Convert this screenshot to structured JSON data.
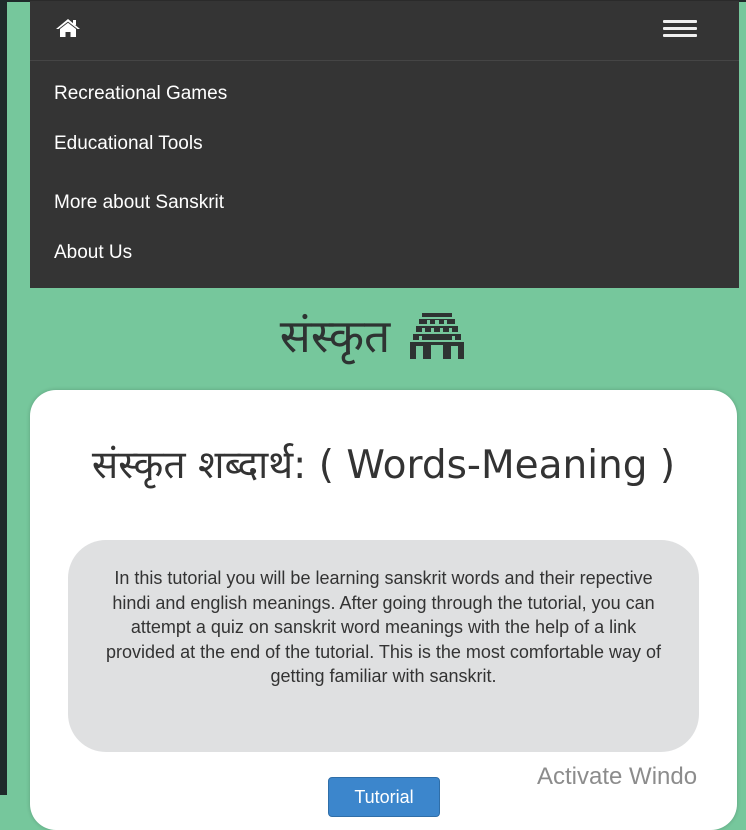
{
  "navbar": {
    "home_icon": "home-icon",
    "menu_icon": "hamburger-menu-icon",
    "links": [
      {
        "label": "Recreational Games"
      },
      {
        "label": "Educational Tools"
      },
      {
        "label": "More about Sanskrit"
      },
      {
        "label": "About Us"
      }
    ]
  },
  "brand": {
    "text": "संस्कृत",
    "icon": "temple-icon"
  },
  "card": {
    "title": "संस्कृत शब्दार्थ: ( Words-Meaning )",
    "intro": "In this tutorial you will be learning sanskrit words and their repective hindi and english meanings. After going through the tutorial, you can attempt a quiz on sanskrit word meanings with the help of a link provided at the end of the tutorial. This is the most comfortable way of getting familiar with sanskrit.",
    "button_label": "Tutorial"
  },
  "watermark": "Activate Windo",
  "colors": {
    "page_background": "#76c79c",
    "navbar_background": "#343434",
    "intro_box_background": "#dfe0e1",
    "button_background": "#3c86cc"
  }
}
